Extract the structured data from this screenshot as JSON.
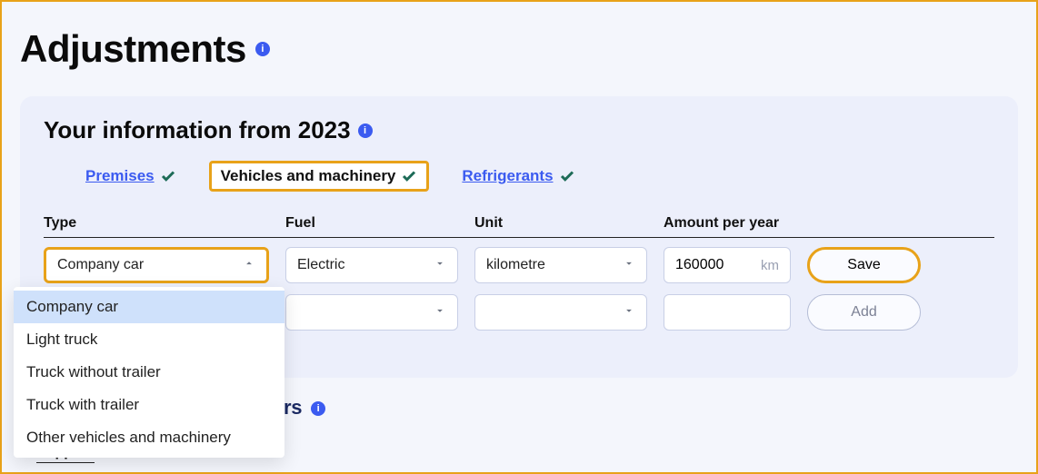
{
  "page_title": "Adjustments",
  "section_title": "Your information from 2023",
  "tabs": {
    "premises": "Premises",
    "vehicles": "Vehicles and machinery",
    "refrigerants": "Refrigerants"
  },
  "columns": {
    "type": "Type",
    "fuel": "Fuel",
    "unit": "Unit",
    "amount": "Amount per year"
  },
  "row1": {
    "type": "Company car",
    "fuel": "Electric",
    "unit": "kilometre",
    "amount": "160000",
    "amount_unit": "km",
    "button": "Save"
  },
  "row2": {
    "button": "Add"
  },
  "type_options": [
    "Company car",
    "Light truck",
    "Truck without trailer",
    "Truck with trailer",
    "Other vehicles and machinery"
  ],
  "partial_text": "rs",
  "supplier_label": "Supplier"
}
